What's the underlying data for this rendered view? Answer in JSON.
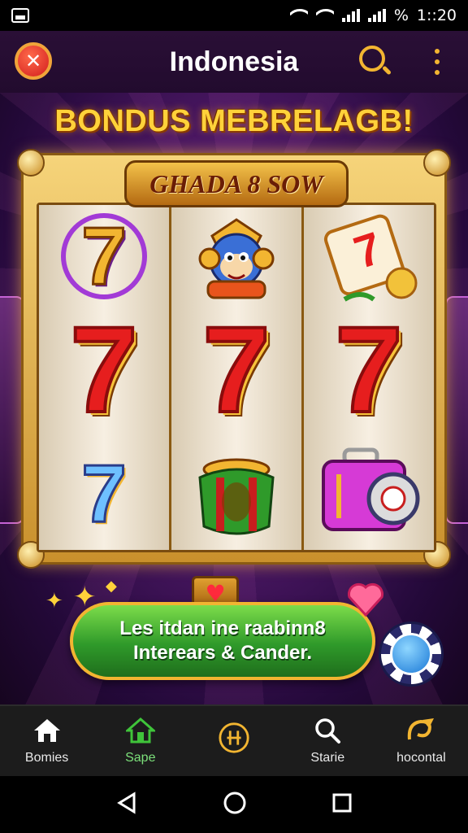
{
  "status_bar": {
    "battery_text": "%",
    "time": "1::20"
  },
  "header": {
    "title": "Indonesia"
  },
  "banner": {
    "text": "BONDUS MEBRELAGB!"
  },
  "slot": {
    "plaque": "GHADA 8 SOW",
    "rows": [
      [
        "gold-seven",
        "monkey",
        "card-and-coin"
      ],
      [
        "red-seven",
        "red-seven",
        "red-seven"
      ],
      [
        "blue-seven",
        "green-drum",
        "pink-camera"
      ]
    ],
    "seven_char": "7"
  },
  "action": {
    "line1": "Les itdan ine raabinn8",
    "line2": "Interears & Cander."
  },
  "bottom_nav": [
    {
      "label": "Bomies",
      "icon": "home-icon",
      "active": false
    },
    {
      "label": "Sape",
      "icon": "store-icon",
      "active": true
    },
    {
      "label": "",
      "icon": "grid-circle-icon",
      "active": false
    },
    {
      "label": "Starie",
      "icon": "search-icon",
      "active": false
    },
    {
      "label": "hocontal",
      "icon": "brand-icon",
      "active": false
    }
  ],
  "colors": {
    "accent_gold": "#f2b531",
    "active_green": "#7ce07a",
    "seven_red": "#e61e1e"
  }
}
